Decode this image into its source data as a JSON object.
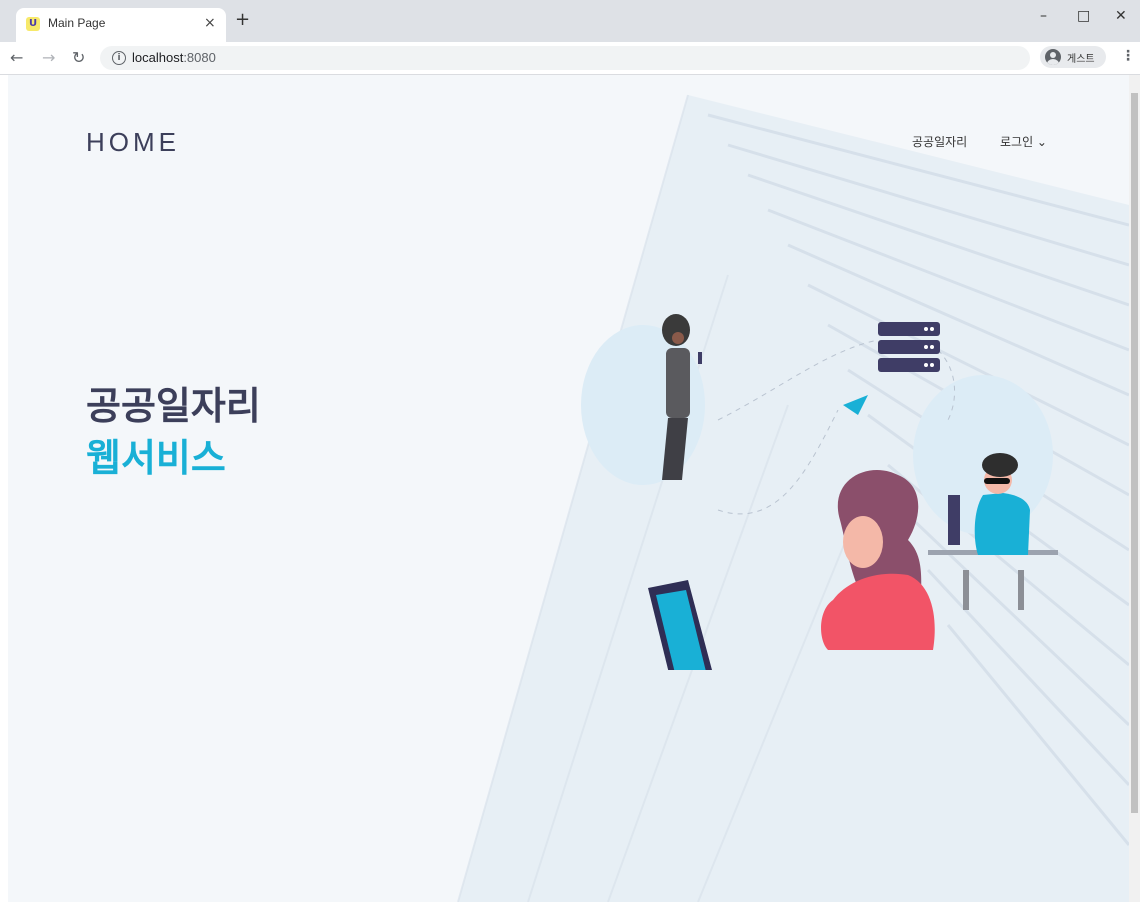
{
  "browser": {
    "tab_title": "Main Page",
    "favicon_letter": "U",
    "url_host": "localhost",
    "url_port": ":8080",
    "profile_label": "게스트",
    "new_tab": "+",
    "close": "×",
    "minimize": "–",
    "maximize": "□",
    "window_close": "✕"
  },
  "nav": {
    "brand": "HOME",
    "jobs": "공공일자리",
    "login": "로그인 ⌄"
  },
  "hero": {
    "line1": "공공일자리",
    "line2": "웹서비스"
  },
  "colors": {
    "accent": "#19b0d6",
    "heading": "#3c3f5a",
    "page_bg": "#f4f7fa"
  },
  "icons": [
    "back-arrow-icon",
    "forward-arrow-icon",
    "reload-icon",
    "info-icon",
    "profile-icon",
    "menu-dots-icon",
    "chevron-down-icon"
  ]
}
